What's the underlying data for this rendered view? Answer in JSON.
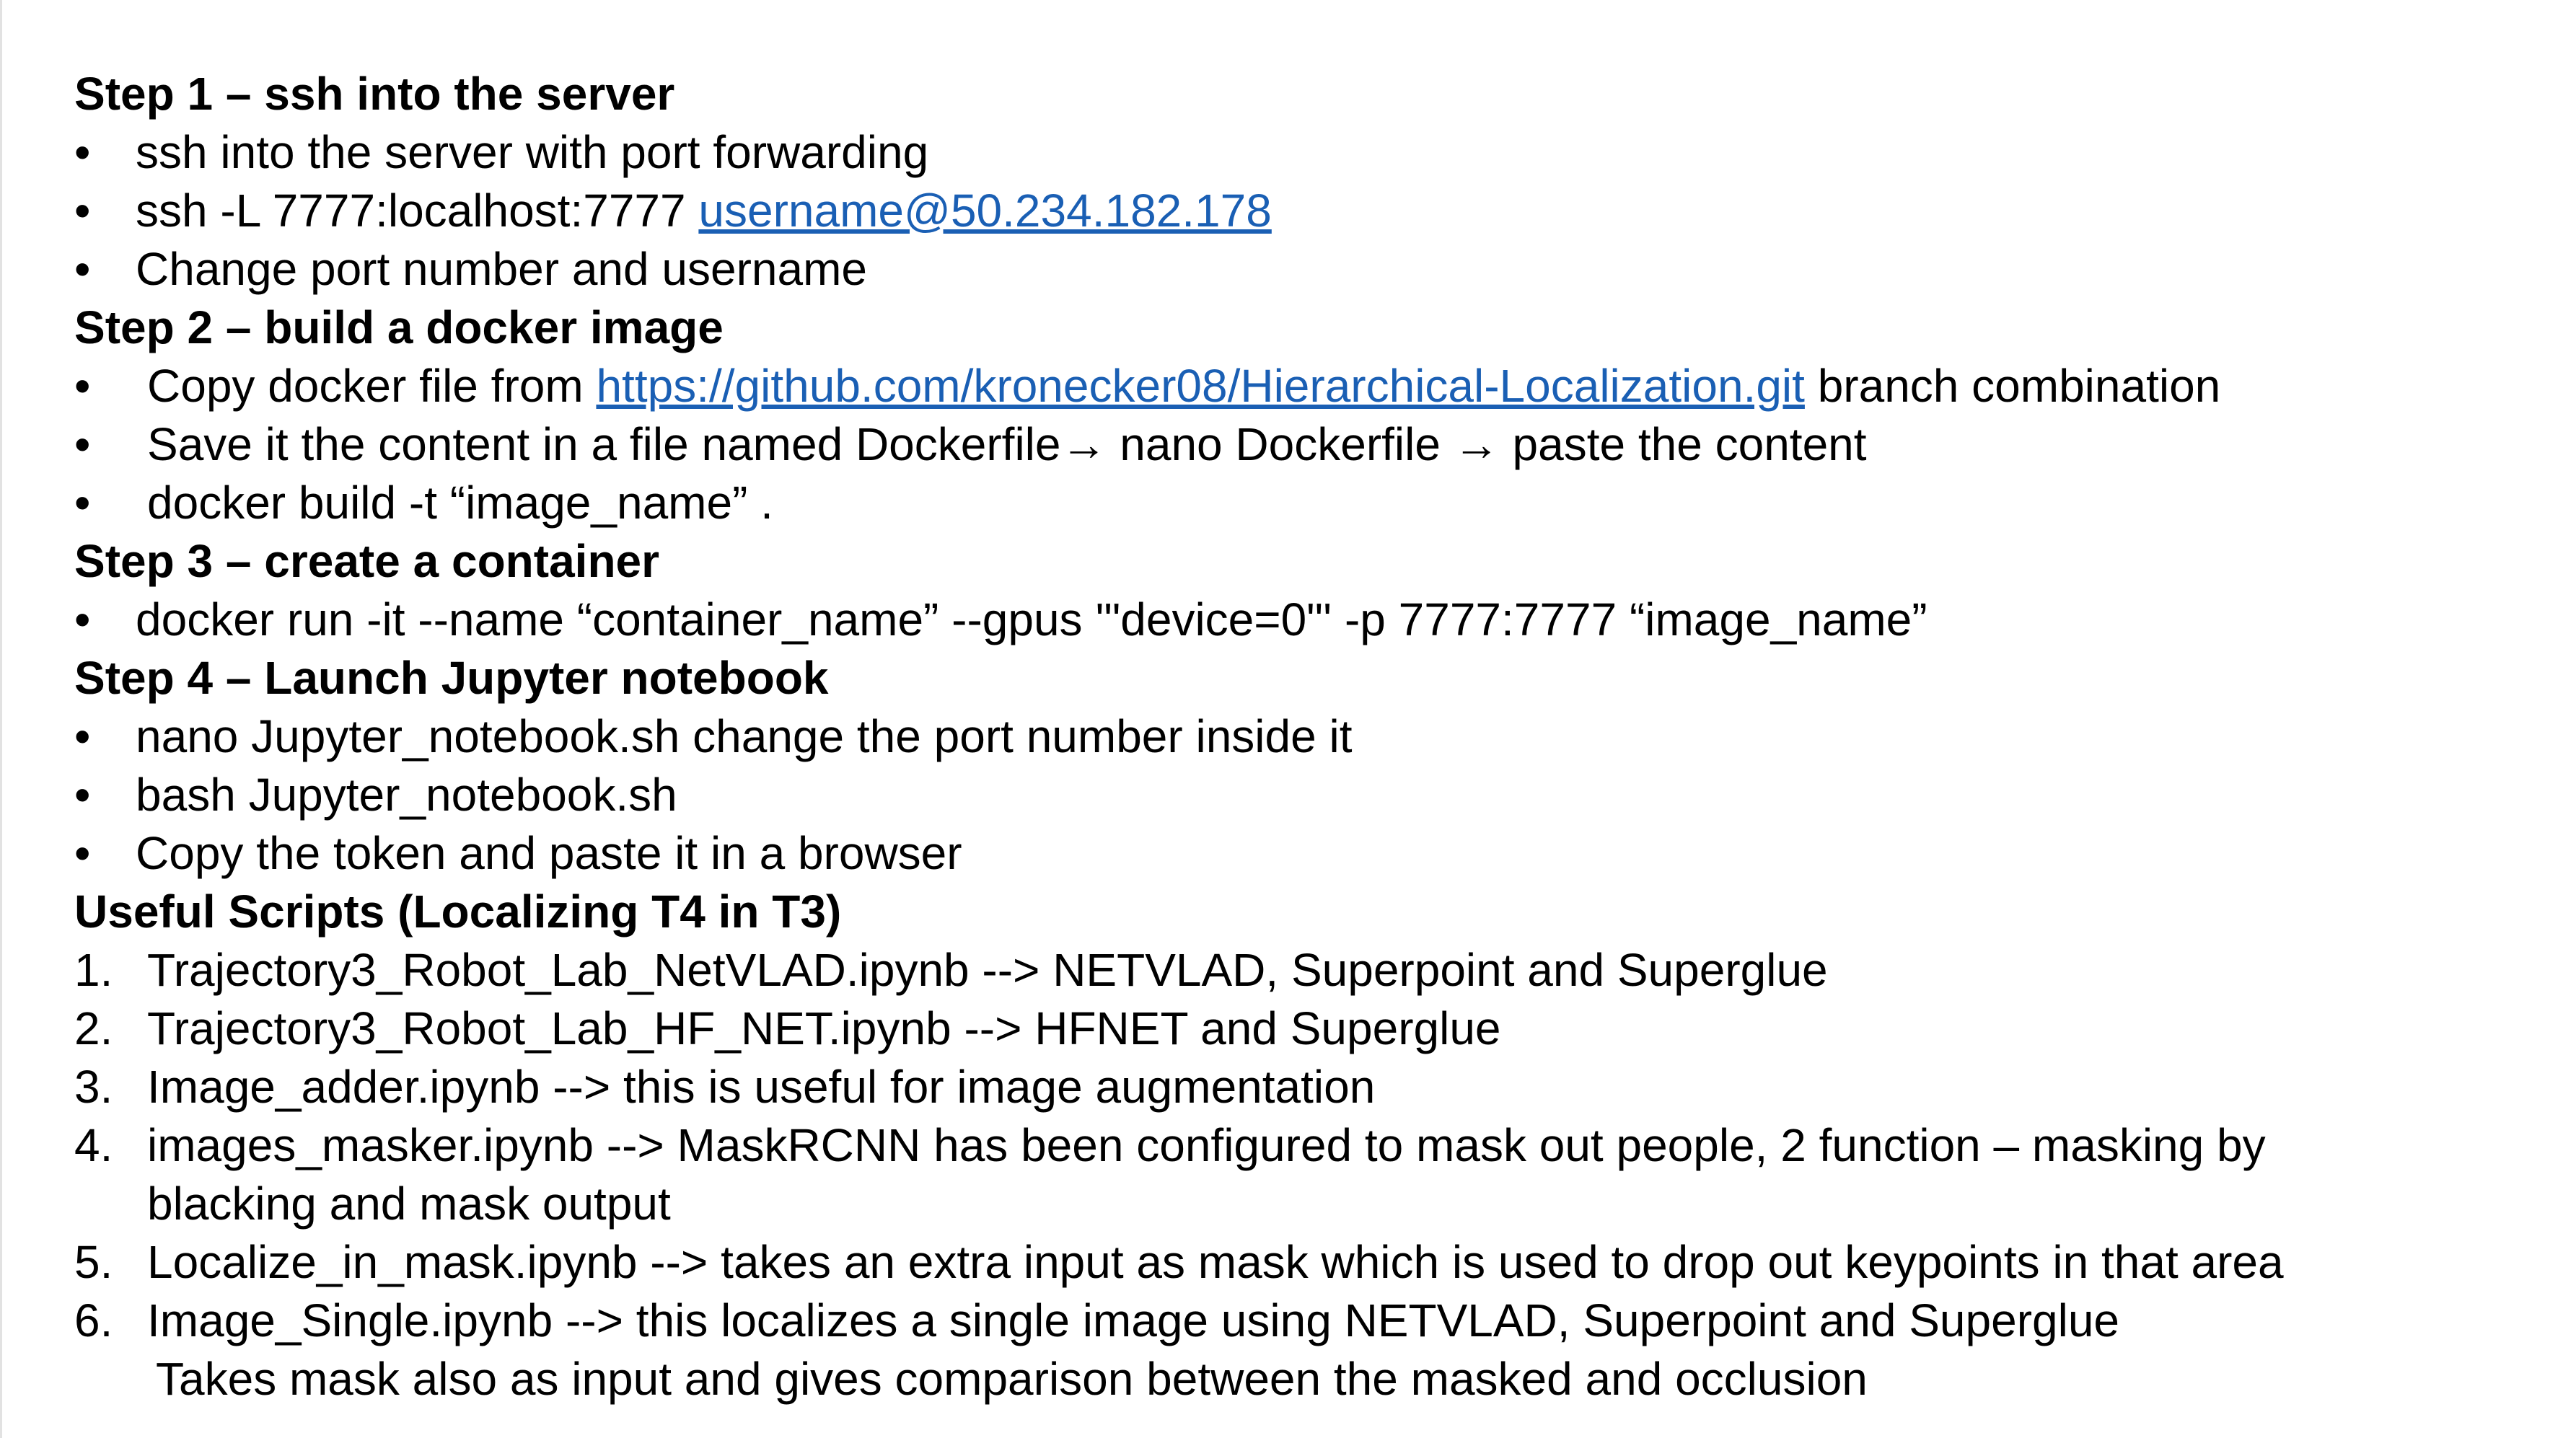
{
  "step1": {
    "heading": "Step 1 – ssh into the server",
    "bullets": [
      "ssh into the server with port forwarding",
      "Change port number and username"
    ],
    "ssh_prefix": "ssh -L 7777:localhost:7777 ",
    "ssh_link": "username@50.234.182.178"
  },
  "step2": {
    "heading": "Step 2 – build a docker image",
    "copy_prefix": "Copy docker file from ",
    "copy_link": "https://github.com/kronecker08/Hierarchical-Localization.git",
    "copy_suffix": " branch combination",
    "bullets": [
      "Save it the content in a file named Dockerfile→ nano Dockerfile → paste the content",
      "docker build -t “image_name”  ."
    ]
  },
  "step3": {
    "heading": "Step 3 – create a container",
    "bullets": [
      "docker run -it --name “container_name” --gpus '\"device=0\"'  -p 7777:7777 “image_name”"
    ]
  },
  "step4": {
    "heading": "Step 4 – Launch Jupyter notebook",
    "bullets": [
      "nano Jupyter_notebook.sh change the port number inside it",
      "bash Jupyter_notebook.sh",
      "Copy the token and paste it in a browser"
    ]
  },
  "scripts": {
    "heading": "Useful Scripts (Localizing T4 in T3)",
    "items": [
      {
        "num": "1.",
        "text": "Trajectory3_Robot_Lab_NetVLAD.ipynb --> NETVLAD, Superpoint and Superglue"
      },
      {
        "num": "2.",
        "text": "Trajectory3_Robot_Lab_HF_NET.ipynb --> HFNET and Superglue"
      },
      {
        "num": "3.",
        "text": "Image_adder.ipynb --> this is useful for image augmentation"
      },
      {
        "num": "4.",
        "text": "images_masker.ipynb --> MaskRCNN has been configured to mask out people, 2 function – masking by",
        "cont": "blacking and mask output"
      },
      {
        "num": "5.",
        "text": "Localize_in_mask.ipynb --> takes an extra input as mask which is used to drop out keypoints in that area"
      },
      {
        "num": "6.",
        "text": "Image_Single.ipynb --> this localizes a single image using NETVLAD, Superpoint and Superglue",
        "cont": "Takes mask also as input and gives comparison between the masked and occlusion"
      }
    ]
  },
  "bullet_symbol": "•",
  "colors": {
    "link": "#1a5fb4",
    "text": "#000000",
    "background": "#ffffff"
  }
}
